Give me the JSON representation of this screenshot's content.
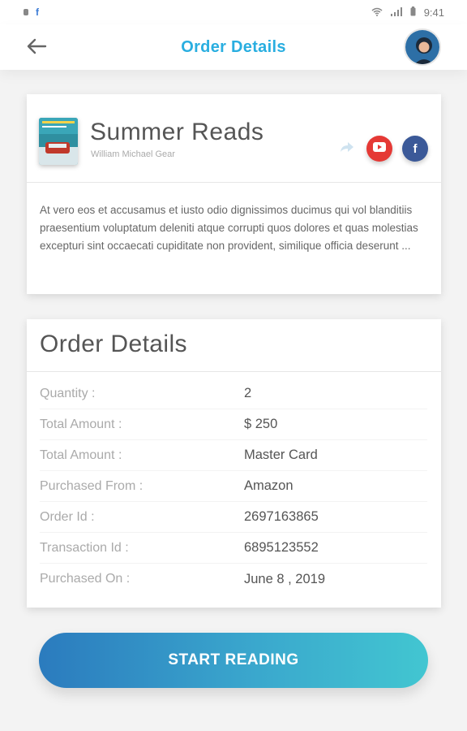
{
  "status_bar": {
    "time": "9:41",
    "icons": [
      "notification-icon",
      "facebook-icon",
      "wifi-icon",
      "signal-icon",
      "battery-icon"
    ]
  },
  "header": {
    "title": "Order Details",
    "back_icon": "arrow-left-icon",
    "avatar": "user-avatar"
  },
  "book": {
    "title": "Summer Reads",
    "author": "William Michael Gear",
    "description": "At vero eos et accusamus et iusto odio dignissimos ducimus qui vol blanditiis praesentium voluptatum deleniti atque corrupti quos dolores et quas molestias excepturi sint occaecati cupiditate non provident, similique  officia deserunt ...",
    "actions": [
      "share-icon",
      "youtube-icon",
      "facebook-icon"
    ]
  },
  "order": {
    "heading": "Order Details",
    "rows": [
      {
        "label": "Quantity :",
        "value": "2"
      },
      {
        "label": "Total Amount :",
        "value": "$ 250"
      },
      {
        "label": "Total Amount :",
        "value": "Master Card"
      },
      {
        "label": "Purchased From :",
        "value": "Amazon"
      },
      {
        "label": "Order Id :",
        "value": "2697163865"
      },
      {
        "label": "Transaction Id :",
        "value": "6895123552"
      },
      {
        "label": "Purchased On :",
        "value": "June 8 , 2019"
      }
    ]
  },
  "cta": {
    "label": "START READING"
  },
  "colors": {
    "title_accent": "#29aee0",
    "button_gradient_start": "#2b7bbe",
    "button_gradient_end": "#42c6d1",
    "youtube": "#e53935",
    "facebook": "#3b5998"
  }
}
